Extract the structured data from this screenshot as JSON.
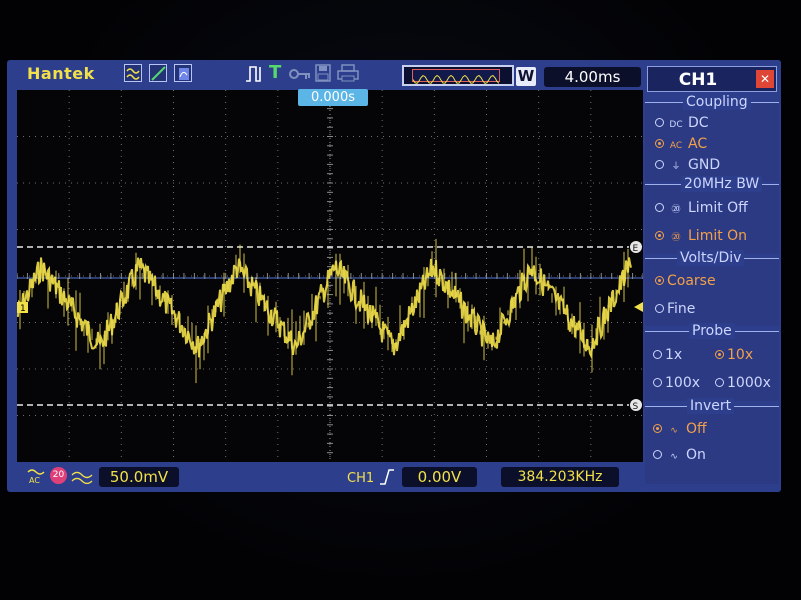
{
  "brand": "Hantek",
  "timebase": {
    "mode_label": "W",
    "value": "4.00ms"
  },
  "trigger_position": "0.000s",
  "trigger_status": "T",
  "markers": {
    "ch1": "1",
    "upper": "E",
    "lower": "S"
  },
  "vertical": {
    "volts_div": "50.0mV",
    "bw_icon": "20"
  },
  "trigger": {
    "source": "CH1",
    "level": "0.00V"
  },
  "frequency": "384.203KHz",
  "menu": {
    "title": "CH1",
    "sections": {
      "coupling": {
        "title": "Coupling",
        "options": [
          "DC",
          "AC",
          "GND"
        ],
        "selected": "AC",
        "glyphs": [
          "DC",
          "AC",
          ""
        ]
      },
      "bw": {
        "title": "20MHz BW",
        "options": [
          "Limit Off",
          "Limit On"
        ],
        "selected": "Limit On"
      },
      "volts": {
        "title": "Volts/Div",
        "options": [
          "Coarse",
          "Fine"
        ],
        "selected": "Coarse"
      },
      "probe": {
        "title": "Probe",
        "options": [
          "1x",
          "10x",
          "100x",
          "1000x"
        ],
        "selected": "10x"
      },
      "invert": {
        "title": "Invert",
        "options": [
          "Off",
          "On"
        ],
        "selected": "Off"
      }
    }
  },
  "colors": {
    "trace": "#f2e04a",
    "accent_selected": "#f2a04a",
    "panel": "#2d3e8c",
    "grid_dot": "#6f6f6f"
  }
}
